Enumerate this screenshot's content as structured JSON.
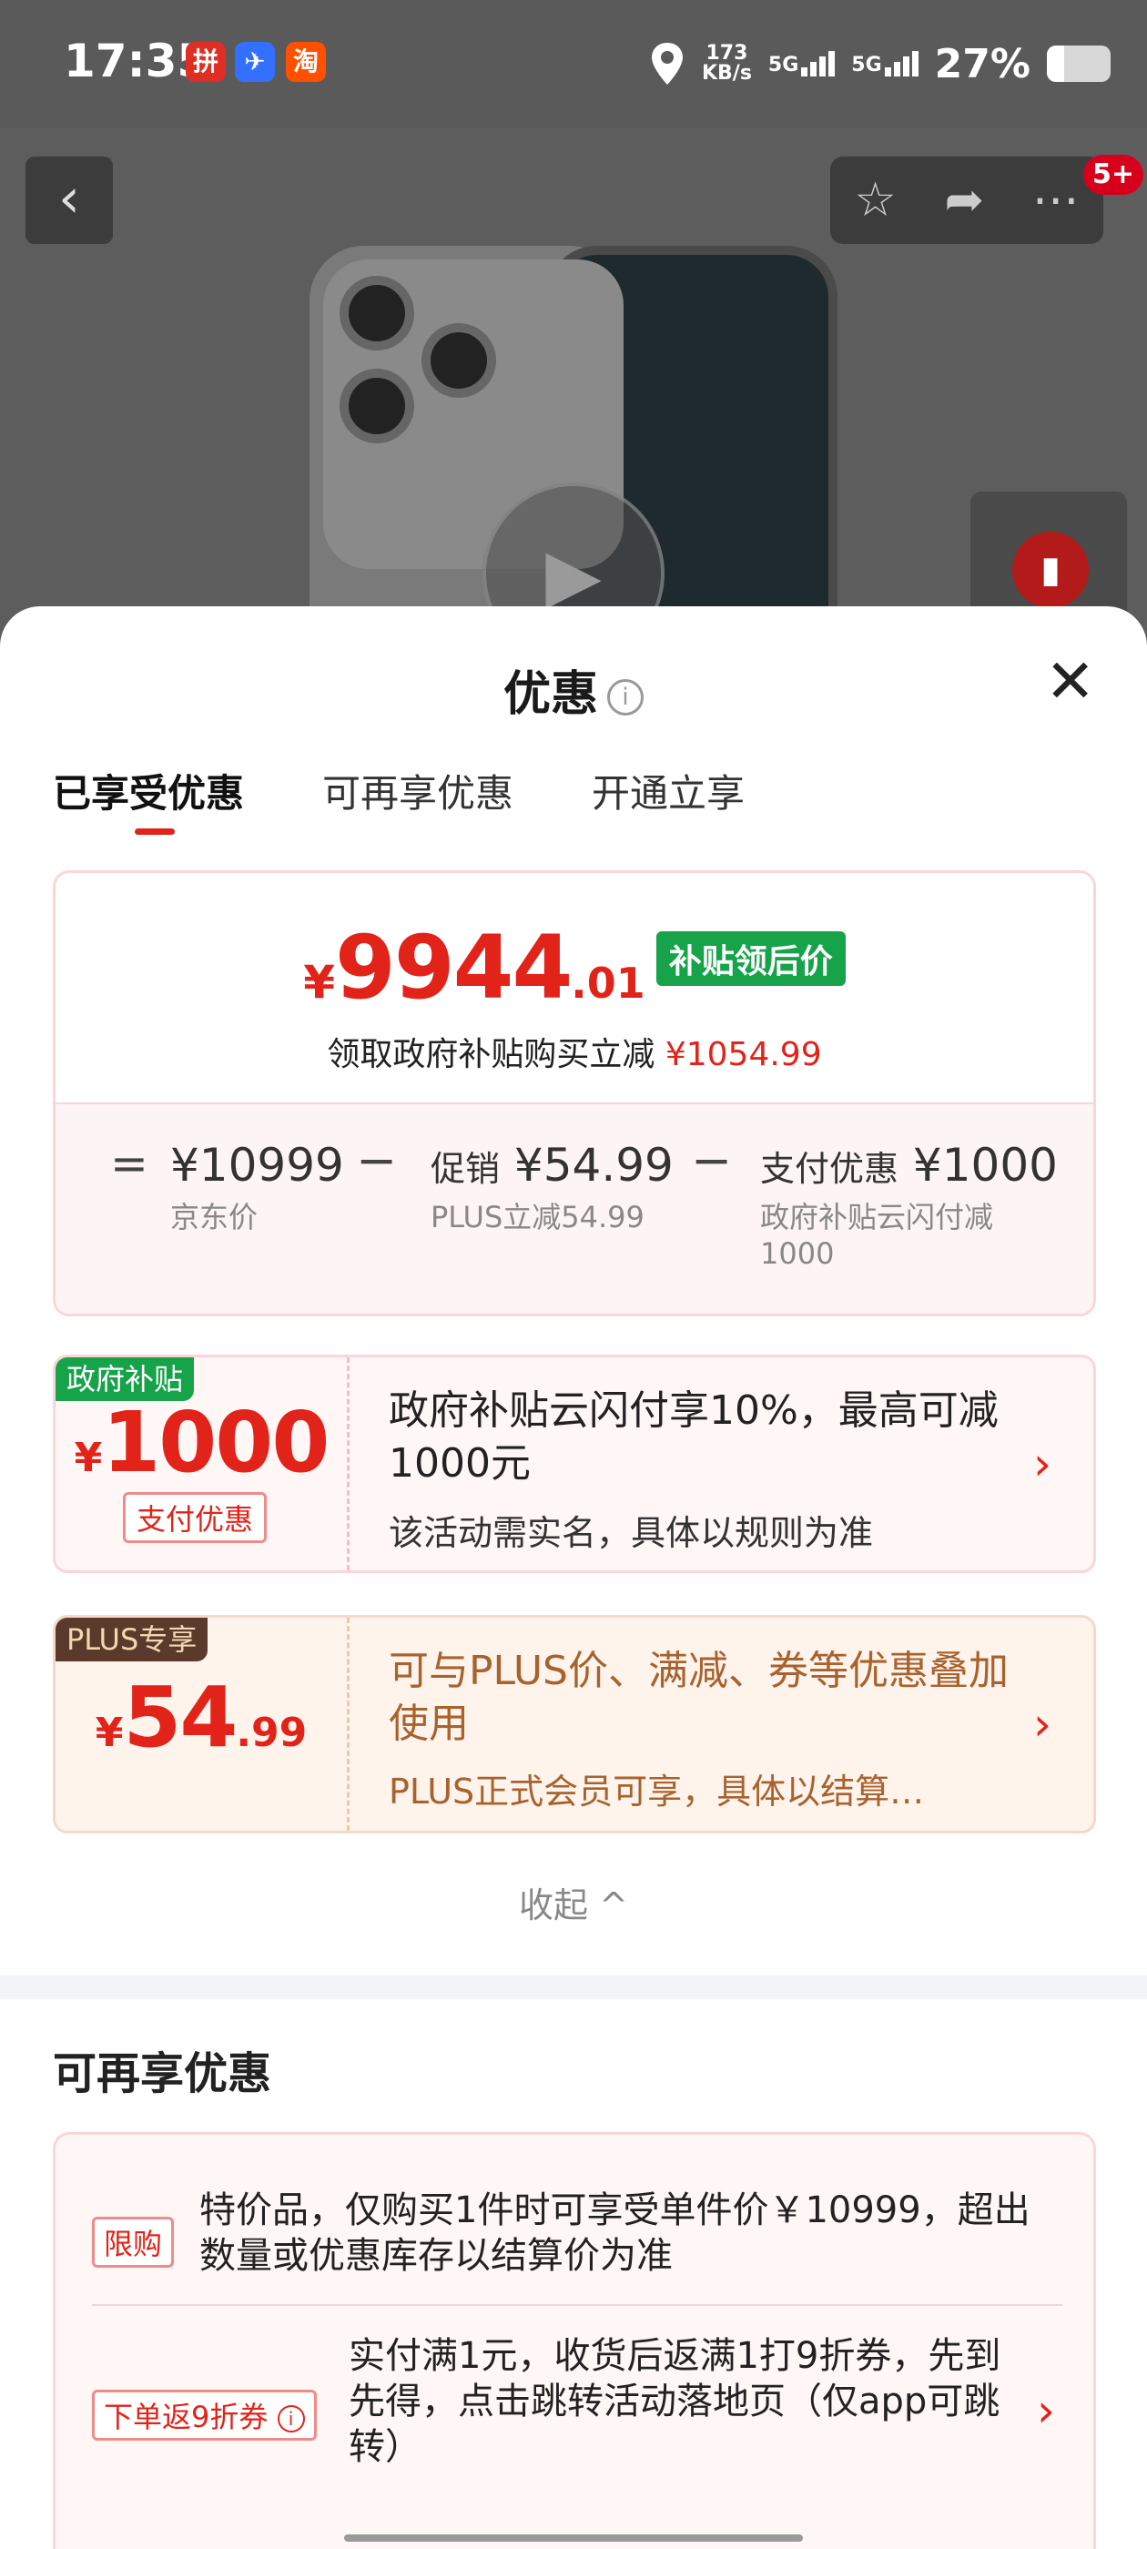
{
  "status_bar": {
    "time": "17:35",
    "app_icons": [
      {
        "name": "pinduoduo-icon",
        "color": "#e02e24",
        "glyph": "拼"
      },
      {
        "name": "feishu-icon",
        "color": "#3370ff",
        "glyph": "✈"
      },
      {
        "name": "taobao-icon",
        "color": "#ff5000",
        "glyph": "淘"
      }
    ],
    "net_speed_value": "173",
    "net_speed_unit": "KB/s",
    "sim1": "5G",
    "sim2": "5G",
    "battery_text": "27%",
    "battery_level": 0.27
  },
  "product": {
    "badge": "5+"
  },
  "sheet": {
    "title": "优惠",
    "tabs": [
      "已享受优惠",
      "可再享优惠",
      "开通立享"
    ],
    "active_tab": 0,
    "price": {
      "currency": "¥",
      "integer": "9944",
      "decimal": ".01",
      "tag": "补贴领后价",
      "sub_label": "领取政府补贴购买立减",
      "sub_value": "¥1054.99"
    },
    "breakdown": {
      "eq": "=",
      "minus": "−",
      "jd_price": "¥10999",
      "jd_label": "京东价",
      "promo_label": "促销",
      "promo_value": "¥54.99",
      "promo_sub": "PLUS立减54.99",
      "pay_label": "支付优惠",
      "pay_value": "¥1000",
      "pay_sub_1": "政府补贴云闪付减",
      "pay_sub_2": "1000"
    },
    "cards": [
      {
        "badge": "政府补贴",
        "currency": "¥",
        "integer": "1000",
        "decimal": "",
        "chip": "支付优惠",
        "title": "政府补贴云闪付享10%，最高可减1000元",
        "desc": "该活动需实名，具体以规则为准"
      },
      {
        "badge": "PLUS专享",
        "currency": "¥",
        "integer": "54",
        "decimal": ".99",
        "chip": "",
        "title": "可与PLUS价、满减、券等优惠叠加使用",
        "desc": "PLUS正式会员可享，具体以结算…"
      }
    ],
    "collapse_label": "收起 ^",
    "more_title": "可再享优惠",
    "more_items": [
      {
        "tag": "限购",
        "text": "特价品，仅购买1件时可享受单件价￥10999，超出数量或优惠库存以结算价为准"
      },
      {
        "tag": "下单返9折券",
        "text": "实付满1元，收货后返满1打9折券，先到先得，点击跳转活动落地页（仅app可跳转）"
      }
    ]
  },
  "colors": {
    "accent_red": "#e2231a",
    "subsidy_green": "#16a34a",
    "plus_brown": "#a8622e"
  }
}
